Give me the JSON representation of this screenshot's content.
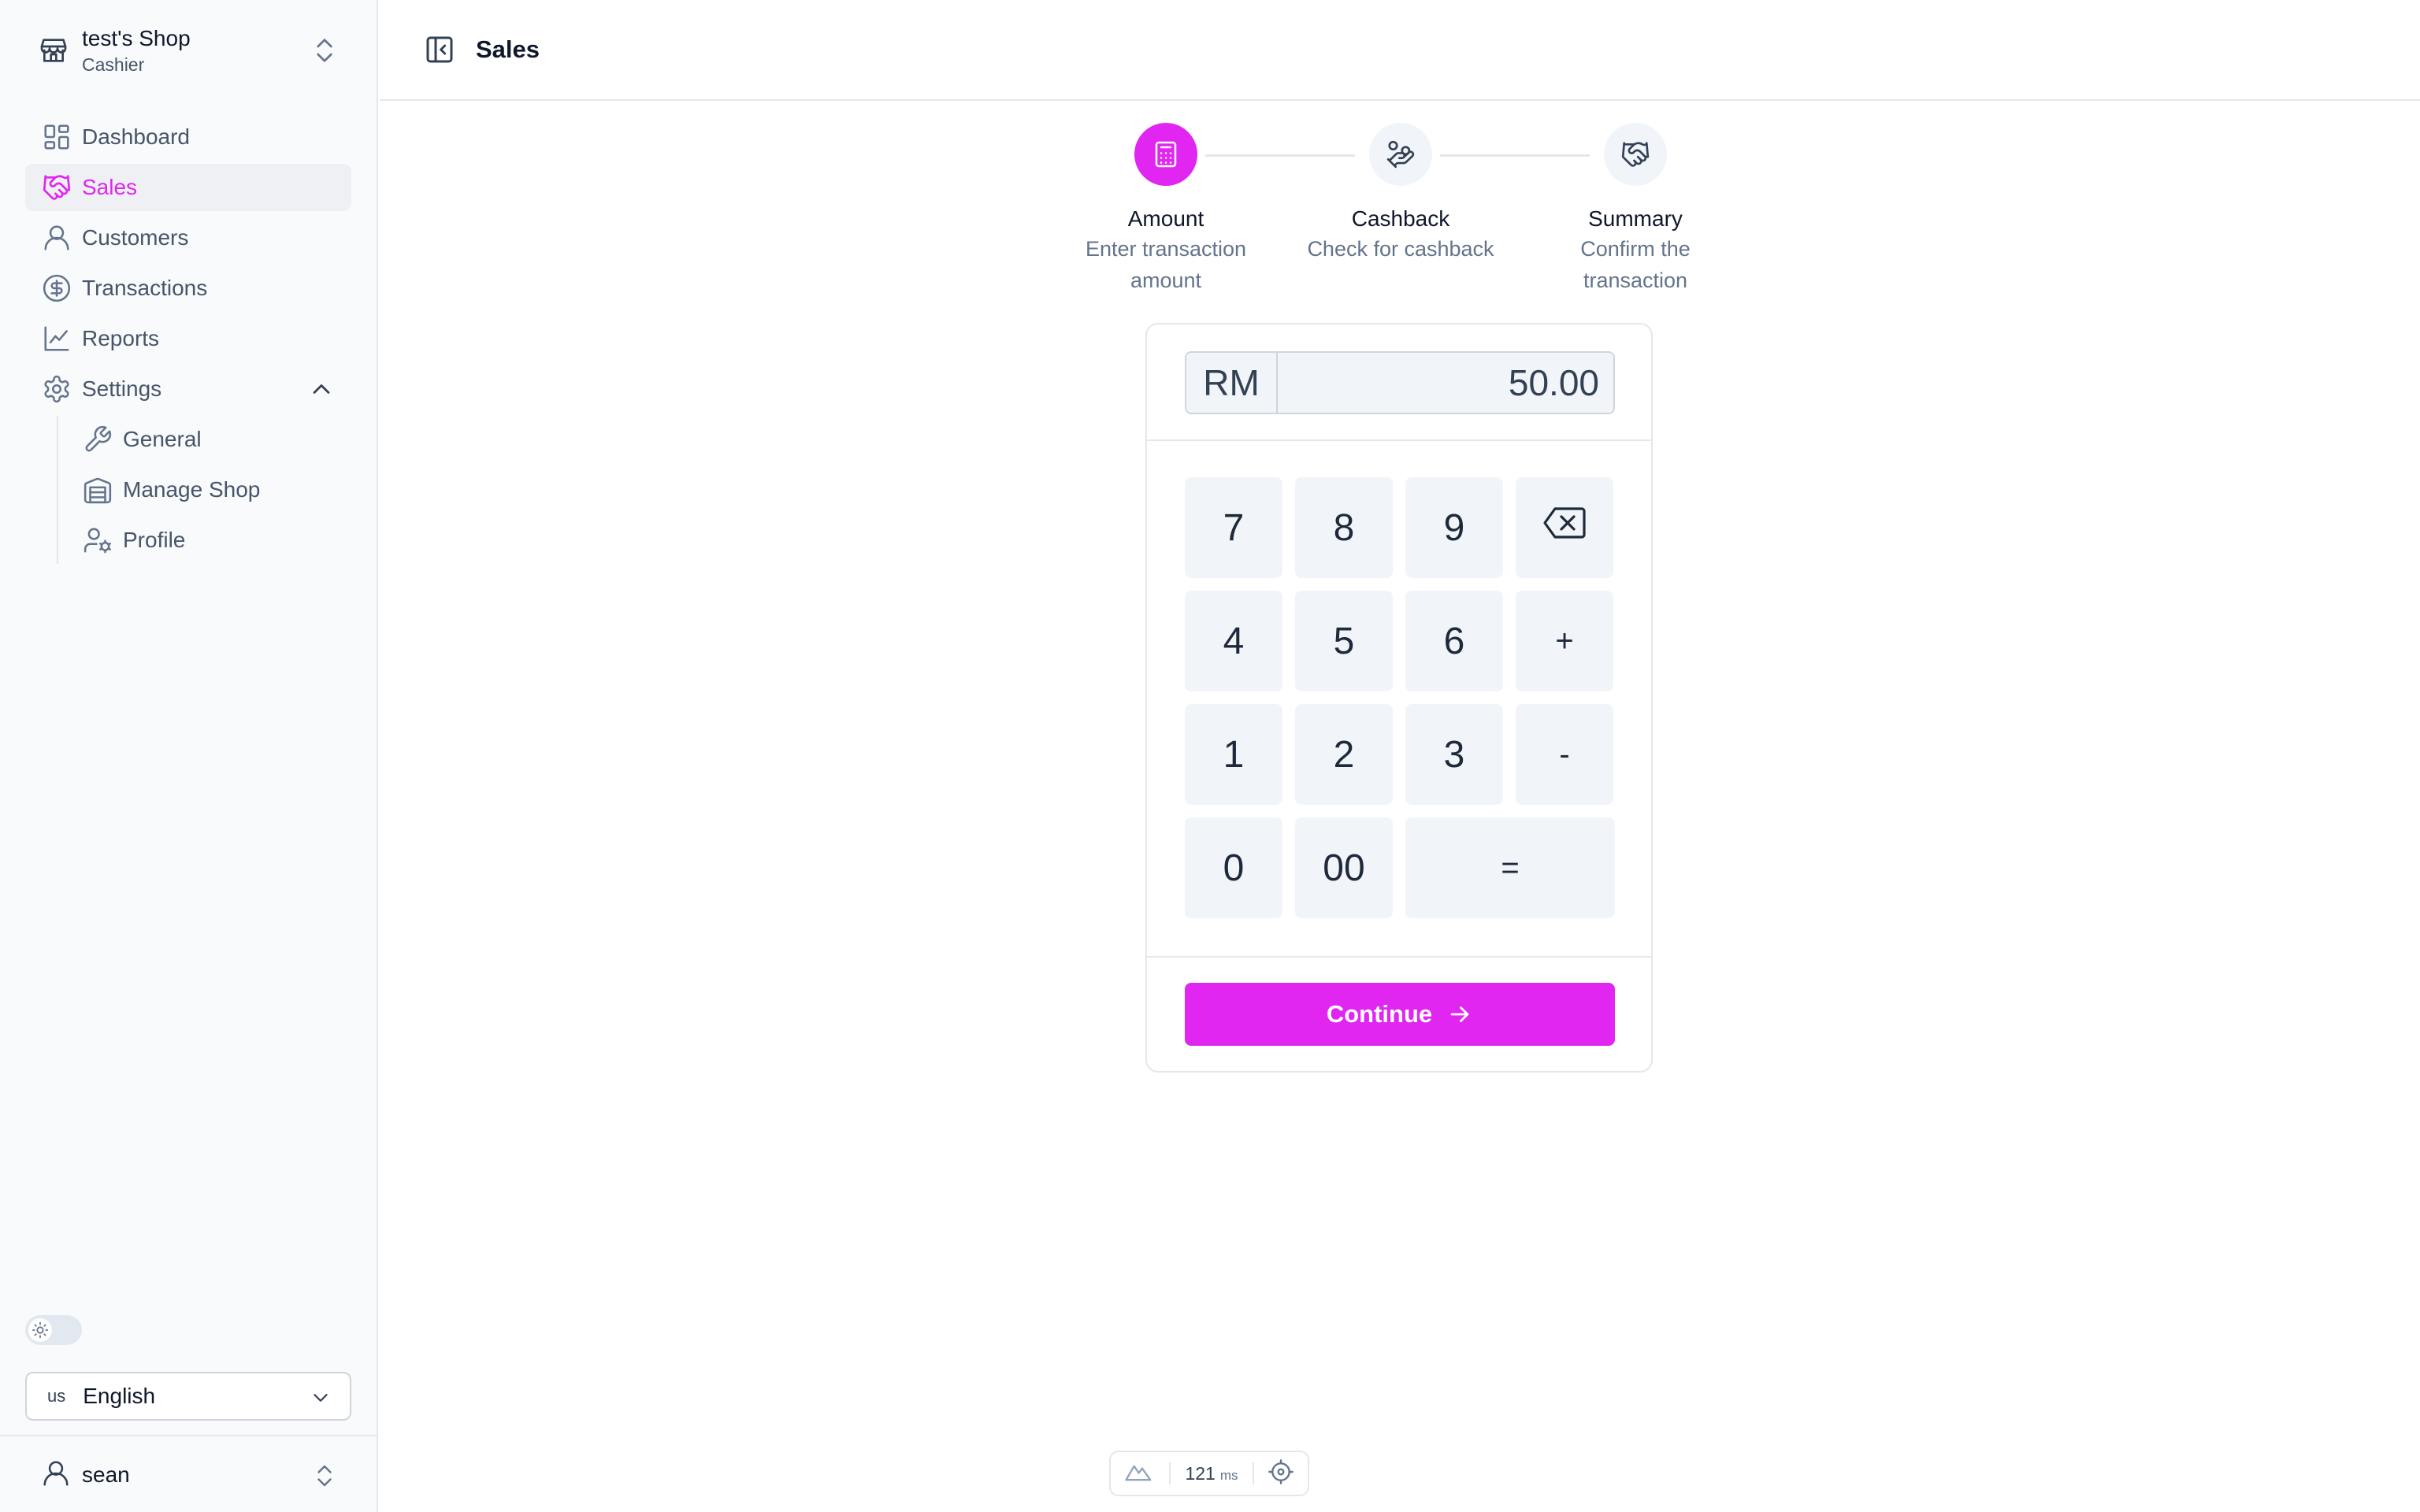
{
  "shop": {
    "name": "test's Shop",
    "role": "Cashier"
  },
  "nav": {
    "items": [
      {
        "label": "Dashboard"
      },
      {
        "label": "Sales"
      },
      {
        "label": "Customers"
      },
      {
        "label": "Transactions"
      },
      {
        "label": "Reports"
      },
      {
        "label": "Settings"
      }
    ],
    "settings_sub": [
      {
        "label": "General"
      },
      {
        "label": "Manage Shop"
      },
      {
        "label": "Profile"
      }
    ]
  },
  "language": {
    "flag": "us",
    "value": "English"
  },
  "user": {
    "name": "sean"
  },
  "header": {
    "title": "Sales"
  },
  "stepper": {
    "steps": [
      {
        "title": "Amount",
        "desc_line1": "Enter transaction",
        "desc_line2": "amount",
        "state": "active"
      },
      {
        "title": "Cashback",
        "desc_line1": "Check for cashback",
        "desc_line2": "",
        "state": "inactive"
      },
      {
        "title": "Summary",
        "desc_line1": "Confirm the",
        "desc_line2": "transaction",
        "state": "inactive"
      }
    ]
  },
  "calculator": {
    "currency": "RM",
    "amount": "50.00",
    "keys": {
      "k7": "7",
      "k8": "8",
      "k9": "9",
      "k4": "4",
      "k5": "5",
      "k6": "6",
      "plus": "+",
      "k1": "1",
      "k2": "2",
      "k3": "3",
      "minus": "-",
      "k0": "0",
      "k00": "00",
      "equals": "="
    },
    "continue_label": "Continue"
  },
  "perf": {
    "value": "121",
    "unit": "ms"
  },
  "colors": {
    "accent": "#e026f0",
    "muted_text": "#64748b",
    "key_bg": "#f1f5f9"
  },
  "icons": {
    "shop": "store-icon",
    "dashboard": "layout-grid-icon",
    "sales": "handshake-icon",
    "customers": "user-icon",
    "transactions": "dollar-circle-icon",
    "reports": "line-chart-icon",
    "settings": "gear-icon",
    "general": "wrench-icon",
    "manage_shop": "warehouse-icon",
    "profile": "user-cog-icon",
    "step_amount": "calculator-icon",
    "step_cashback": "hand-coins-icon",
    "step_summary": "handshake-icon",
    "backspace": "backspace-icon"
  }
}
